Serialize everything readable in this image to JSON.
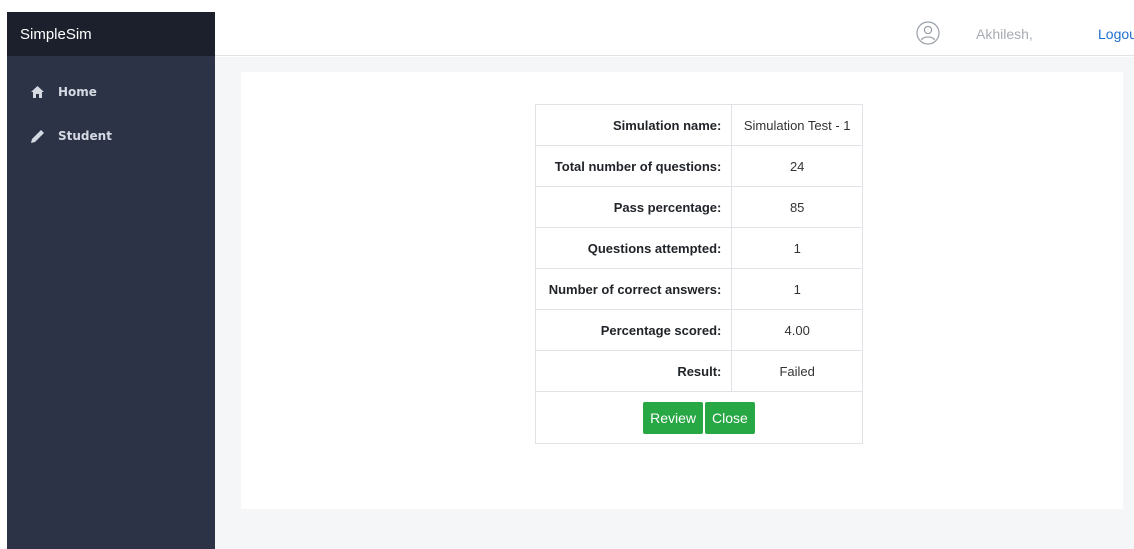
{
  "sidebar": {
    "brand": "SimpleSim",
    "items": [
      {
        "label": "Home",
        "icon": "home-icon"
      },
      {
        "label": "Student",
        "icon": "pencil-icon"
      }
    ]
  },
  "header": {
    "user_icon": "user-avatar-icon",
    "user_name": "Akhilesh,",
    "logout_label": "Logout"
  },
  "results": {
    "rows": [
      {
        "label": "Simulation name:",
        "value": "Simulation Test - 1"
      },
      {
        "label": "Total number of questions:",
        "value": "24"
      },
      {
        "label": "Pass percentage:",
        "value": "85"
      },
      {
        "label": "Questions attempted:",
        "value": "1"
      },
      {
        "label": "Number of correct answers:",
        "value": "1"
      },
      {
        "label": "Percentage scored:",
        "value": "4.00"
      },
      {
        "label": "Result:",
        "value": "Failed"
      }
    ],
    "review_label": "Review",
    "close_label": "Close"
  },
  "colors": {
    "sidebar_bg": "#2c3347",
    "brand_bg": "#1c202c",
    "button_green": "#28a745",
    "link_blue": "#1f6fd1"
  }
}
